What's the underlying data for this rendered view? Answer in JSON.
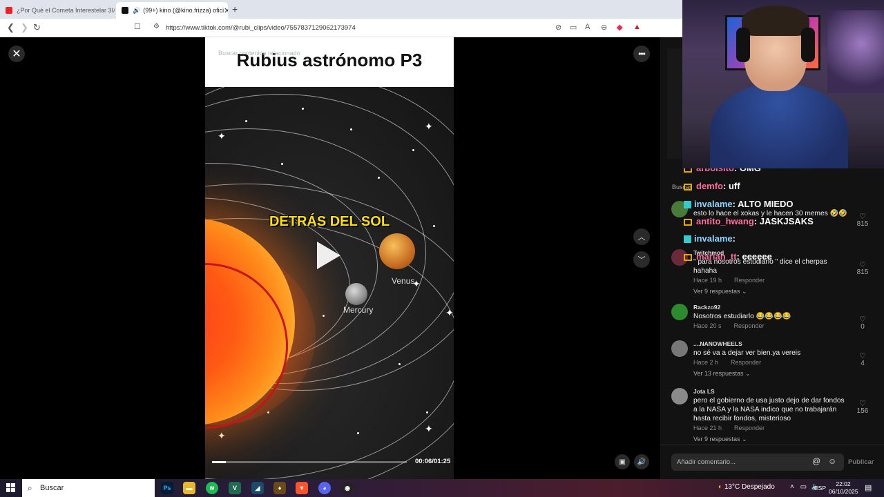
{
  "browser": {
    "tabs": [
      {
        "label": "¿Por Qué el Cometa Interestelar 3I/A",
        "active": false
      },
      {
        "label": "(99+) kino (@kino.frizza) ofici",
        "active": true
      }
    ],
    "new_tab": "+",
    "url": "https://www.tiktok.com/@rubi_clips/video/7557837129062173974"
  },
  "video": {
    "title": "Rubius astrónomo P3",
    "search_overlay": "Buscar contenido relacionado",
    "caption": "DETRÁS DEL SOL",
    "planets": {
      "venus": "Venus",
      "mercury": "Mercury"
    },
    "timecode": "00:06/01:25",
    "progress_fraction": 0.07
  },
  "stream_chat": [
    {
      "user": "arbolsito",
      "message": ": OMG",
      "color": "pink"
    },
    {
      "user": "demfo",
      "message": ": uff",
      "color": "pink"
    },
    {
      "user": "invalame",
      "message": ": ALTO MIEDO",
      "color": "blue"
    },
    {
      "user": "antito_hwang",
      "message": ": JASKJSAKS",
      "color": "pink"
    },
    {
      "user": "invalame",
      "message": ":",
      "color": "blue"
    },
    {
      "user": "marian_tt",
      "message": ": eeeeee",
      "color": "pink"
    }
  ],
  "comments_search": "Buscar",
  "comments": [
    {
      "user": "",
      "text": "esto lo hace el xokas y le hacen 30 memes 🤣🤣",
      "time": "",
      "reply": "",
      "more": "",
      "likes": "815",
      "avatar": "#4a7a3a"
    },
    {
      "user": "Twitchmod",
      "text": "\" para nosotros estudiarlo \" dice el cherpas hahaha",
      "time": "Hace 19 h",
      "reply": "Responder",
      "more": "Ver 9 respuestas",
      "likes": "815",
      "avatar": "#6b2a3a"
    },
    {
      "user": "Rackzo92",
      "text": "Nosotros estudiarlo 😂😂😂😂",
      "time": "Hace 20 s",
      "reply": "Responder",
      "more": "",
      "likes": "0",
      "avatar": "#2d8a2d"
    },
    {
      "user": "....NANOWHEELS",
      "text": "no sé va a dejar ver bien.ya vereis",
      "time": "Hace 2 h",
      "reply": "Responder",
      "more": "Ver 13 respuestas",
      "likes": "4",
      "avatar": "#777"
    },
    {
      "user": "Jota LS",
      "text": "pero el gobierno de usa justo dejo de dar fondos a la NASA y la NASA indico que no trabajarán hasta recibir fondos, misterioso",
      "time": "Hace 21 h",
      "reply": "Responder",
      "more": "Ver 9 respuestas",
      "likes": "156",
      "avatar": "#8a8a8a"
    }
  ],
  "input": {
    "placeholder": "Añadir comentario...",
    "publish": "Publicar"
  },
  "taskbar": {
    "search": "Buscar",
    "weather": "13°C  Despejado",
    "lang": "ESP",
    "time": "22:02",
    "date": "06/10/2025"
  }
}
